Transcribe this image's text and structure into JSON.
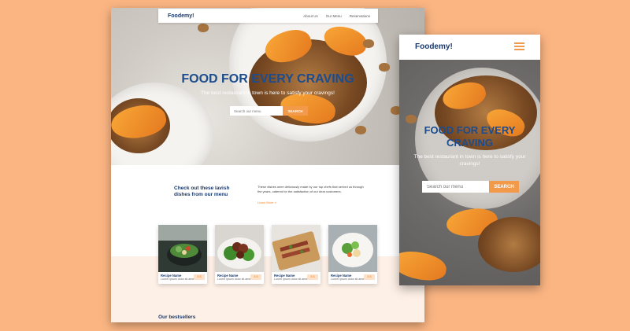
{
  "desktop": {
    "nav": {
      "logo": "Foodemy!",
      "links": [
        "About Us",
        "Our Menu",
        "Reservations"
      ]
    },
    "hero": {
      "title": "FOOD FOR EVERY CRAVING",
      "subtitle": "The best restaurant in town is here to satisfy your cravings!",
      "search_placeholder": "Search our menu",
      "search_button": "SEARCH"
    },
    "intro": {
      "heading": "Check out these lavish dishes from our menu",
      "body": "These dishes were deliciously made by our top chefs that served us through the years, catered for the satisfaction of our dear customers.",
      "link": "Learn More »"
    },
    "recipes": [
      {
        "name": "Recipe Name",
        "desc": "Lorem ipsum dolor sit amet.",
        "price": "$ $"
      },
      {
        "name": "Recipe Name",
        "desc": "Lorem ipsum dolor sit amet.",
        "price": "$ $"
      },
      {
        "name": "Recipe Name",
        "desc": "Lorem ipsum dolor sit amet.",
        "price": "$ $"
      },
      {
        "name": "Recipe Name",
        "desc": "Lorem ipsum dolor sit amet.",
        "price": "$ $"
      }
    ],
    "bestsellers": "Our bestsellers"
  },
  "mobile": {
    "logo": "Foodemy!",
    "menu_icon": "hamburger-icon",
    "hero": {
      "title": "FOOD FOR EVERY CRAVING",
      "subtitle": "The best restaurant in town is here to satisfy your cravings!",
      "search_placeholder": "Search our menu",
      "search_button": "SEARCH"
    }
  },
  "colors": {
    "background": "#fbb583",
    "brand_blue": "#1b3a6b",
    "accent_orange": "#f29a4a"
  }
}
